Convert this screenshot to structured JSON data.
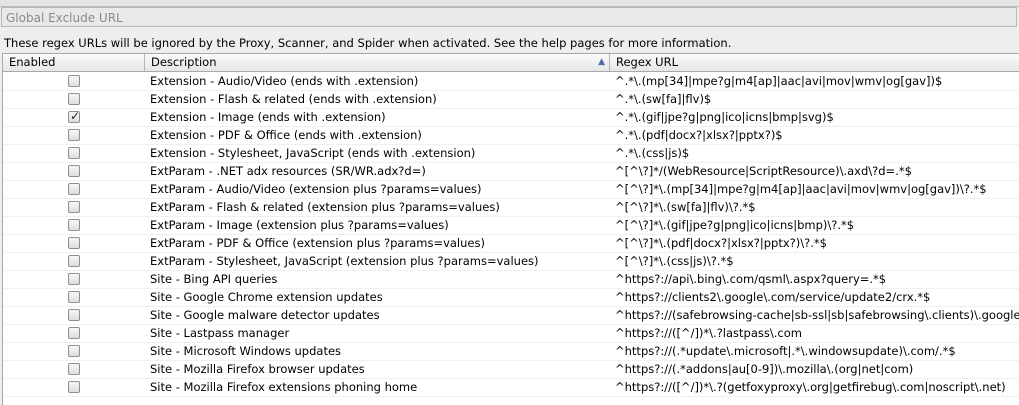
{
  "panel": {
    "title": "Global Exclude URL",
    "info": "These regex URLs will be ignored by the Proxy, Scanner, and Spider when activated. See the help pages for more information."
  },
  "table": {
    "headers": {
      "enabled": "Enabled",
      "description": "Description",
      "regex": "Regex URL"
    },
    "sort_indicator": "▲",
    "rows": [
      {
        "enabled": false,
        "description": "Extension - Audio/Video (ends with .extension)",
        "regex": "^.*\\.(mp[34]|mpe?g|m4[ap]|aac|avi|mov|wmv|og[gav])$"
      },
      {
        "enabled": false,
        "description": "Extension - Flash & related (ends with .extension)",
        "regex": "^.*\\.(sw[fa]|flv)$"
      },
      {
        "enabled": true,
        "description": "Extension - Image (ends with .extension)",
        "regex": "^.*\\.(gif|jpe?g|png|ico|icns|bmp|svg)$"
      },
      {
        "enabled": false,
        "description": "Extension - PDF & Office (ends with .extension)",
        "regex": "^.*\\.(pdf|docx?|xlsx?|pptx?)$"
      },
      {
        "enabled": false,
        "description": "Extension - Stylesheet, JavaScript (ends with .extension)",
        "regex": "^.*\\.(css|js)$"
      },
      {
        "enabled": false,
        "description": "ExtParam - .NET adx resources (SR/WR.adx?d=)",
        "regex": "^[^\\?]*/(WebResource|ScriptResource)\\.axd\\?d=.*$"
      },
      {
        "enabled": false,
        "description": "ExtParam - Audio/Video (extension plus ?params=values)",
        "regex": "^[^\\?]*\\.(mp[34]|mpe?g|m4[ap]|aac|avi|mov|wmv|og[gav])\\?.*$"
      },
      {
        "enabled": false,
        "description": "ExtParam - Flash & related (extension plus ?params=values)",
        "regex": "^[^\\?]*\\.(sw[fa]|flv)\\?.*$"
      },
      {
        "enabled": false,
        "description": "ExtParam - Image (extension plus ?params=values)",
        "regex": "^[^\\?]*\\.(gif|jpe?g|png|ico|icns|bmp)\\?.*$"
      },
      {
        "enabled": false,
        "description": "ExtParam - PDF & Office (extension plus ?params=values)",
        "regex": "^[^\\?]*\\.(pdf|docx?|xlsx?|pptx?)\\?.*$"
      },
      {
        "enabled": false,
        "description": "ExtParam - Stylesheet, JavaScript (extension plus ?params=values)",
        "regex": "^[^\\?]*\\.(css|js)\\?.*$"
      },
      {
        "enabled": false,
        "description": "Site - Bing API queries",
        "regex": "^https?://api\\.bing\\.com/qsml\\.aspx?query=.*$"
      },
      {
        "enabled": false,
        "description": "Site - Google Chrome extension updates",
        "regex": "^https?://clients2\\.google\\.com/service/update2/crx.*$"
      },
      {
        "enabled": false,
        "description": "Site - Google malware detector updates",
        "regex": "^https?://(safebrowsing-cache|sb-ssl|sb|safebrowsing\\.clients)\\.google\\..."
      },
      {
        "enabled": false,
        "description": "Site - Lastpass manager",
        "regex": "^https?://([^/])*\\.?lastpass\\.com"
      },
      {
        "enabled": false,
        "description": "Site - Microsoft Windows updates",
        "regex": "^https?://(.*update\\.microsoft|.*\\.windowsupdate)\\.com/.*$"
      },
      {
        "enabled": false,
        "description": "Site - Mozilla Firefox browser updates",
        "regex": "^https?://(.*addons|au[0-9])\\.mozilla\\.(org|net|com)"
      },
      {
        "enabled": false,
        "description": "Site - Mozilla Firefox extensions phoning home",
        "regex": "^https?://([^/])*\\.?(getfoxyproxy\\.org|getfirebug\\.com|noscript\\.net)"
      }
    ]
  }
}
